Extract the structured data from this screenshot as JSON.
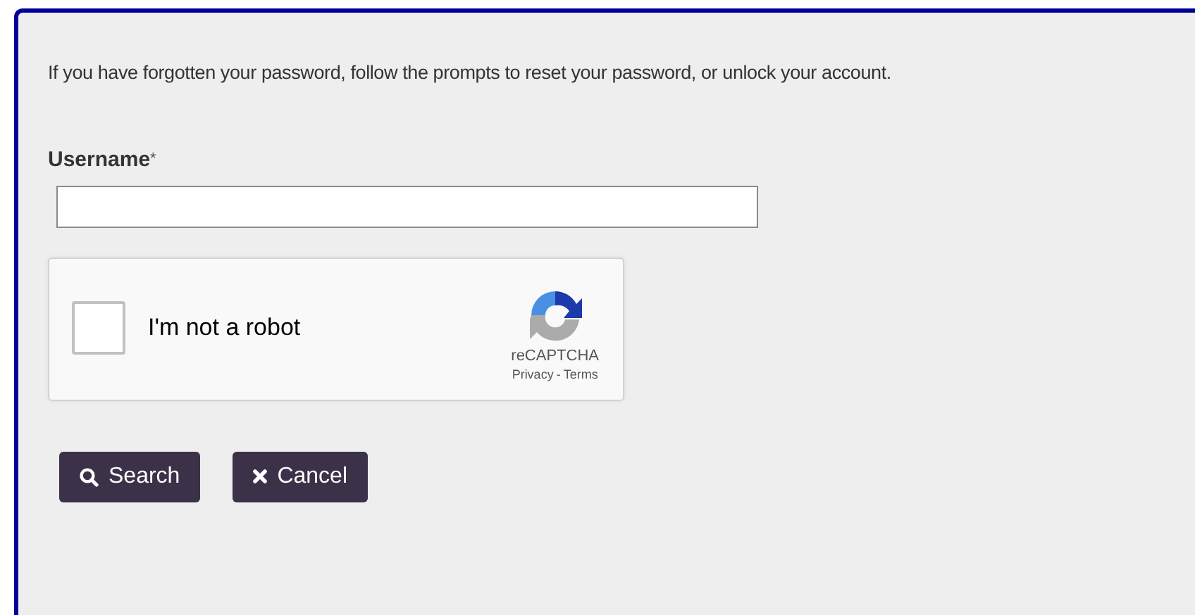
{
  "intro": "If you have forgotten your password, follow the prompts to reset your password, or unlock your account.",
  "username": {
    "label": "Username",
    "required_mark": "*"
  },
  "captcha": {
    "label": "I'm not a robot",
    "checked": false,
    "brand": "reCAPTCHA",
    "privacy": "Privacy",
    "separator": "-",
    "terms": "Terms"
  },
  "buttons": [
    {
      "kind": "search",
      "label": "Search"
    },
    {
      "kind": "cancel",
      "label": "Cancel"
    }
  ]
}
